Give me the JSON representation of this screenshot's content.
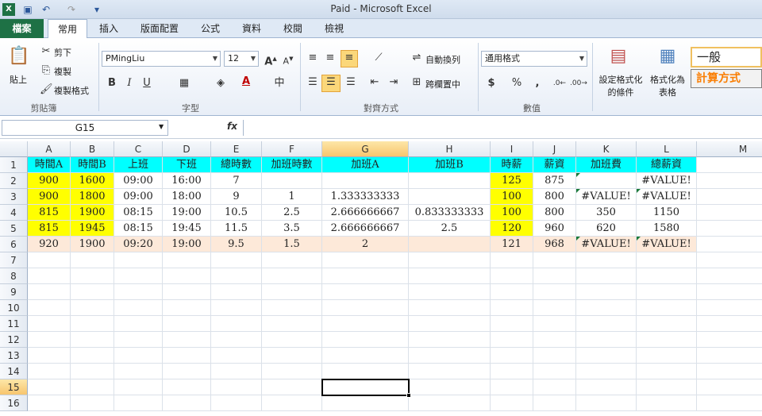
{
  "window": {
    "title": "Paid - Microsoft Excel"
  },
  "tabs": [
    "檔案",
    "常用",
    "插入",
    "版面配置",
    "公式",
    "資料",
    "校閱",
    "檢視"
  ],
  "ribbon": {
    "clipboard": {
      "paste": "貼上",
      "cut": "剪下",
      "copy": "複製",
      "format_painter": "複製格式",
      "label": "剪貼簿"
    },
    "font": {
      "name": "PMingLiu",
      "size": "12",
      "label": "字型"
    },
    "alignment": {
      "wrap": "自動換列",
      "merge": "跨欄置中",
      "label": "對齊方式"
    },
    "number": {
      "format": "通用格式",
      "label": "數值"
    },
    "styles": {
      "cond_format": "設定格式化的條件",
      "cond_l1": "設定格式化",
      "cond_l2": "的條件",
      "table_l1": "格式化為",
      "table_l2": "表格",
      "normal": "一般",
      "calc": "計算方式"
    }
  },
  "formula_bar": {
    "name_box": "G15",
    "fx": "fx",
    "value": ""
  },
  "columns": [
    "A",
    "B",
    "C",
    "D",
    "E",
    "F",
    "G",
    "H",
    "I",
    "J",
    "K",
    "L",
    "M"
  ],
  "rows": [
    "1",
    "2",
    "3",
    "4",
    "5",
    "6",
    "7",
    "8",
    "9",
    "10",
    "11",
    "12",
    "13",
    "14",
    "15",
    "16"
  ],
  "cells": [
    [
      "時間A",
      "時間B",
      "上班",
      "下班",
      "總時數",
      "加班時數",
      "加班A",
      "加班B",
      "時薪",
      "薪資",
      "加班費",
      "總薪資"
    ],
    [
      "900",
      "1600",
      "09:00",
      "16:00",
      "7",
      "",
      "",
      "",
      "125",
      "875",
      "",
      "#VALUE!"
    ],
    [
      "900",
      "1800",
      "09:00",
      "18:00",
      "9",
      "1",
      "1.333333333",
      "",
      "100",
      "800",
      "#VALUE!",
      "#VALUE!"
    ],
    [
      "815",
      "1900",
      "08:15",
      "19:00",
      "10.5",
      "2.5",
      "2.666666667",
      "0.833333333",
      "100",
      "800",
      "350",
      "1150"
    ],
    [
      "815",
      "1945",
      "08:15",
      "19:45",
      "11.5",
      "3.5",
      "2.666666667",
      "2.5",
      "120",
      "960",
      "620",
      "1580"
    ],
    [
      "920",
      "1900",
      "09:20",
      "19:00",
      "9.5",
      "1.5",
      "2",
      "",
      "121",
      "968",
      "#VALUE!",
      "#VALUE!"
    ]
  ],
  "colors": {
    "header_fill": "#00ffff",
    "yellow": "#ffff00",
    "peach": "#fde9d9",
    "excel_green": "#1e7145",
    "error_tri": "#1a7a3a"
  },
  "selected_cell": "G15"
}
